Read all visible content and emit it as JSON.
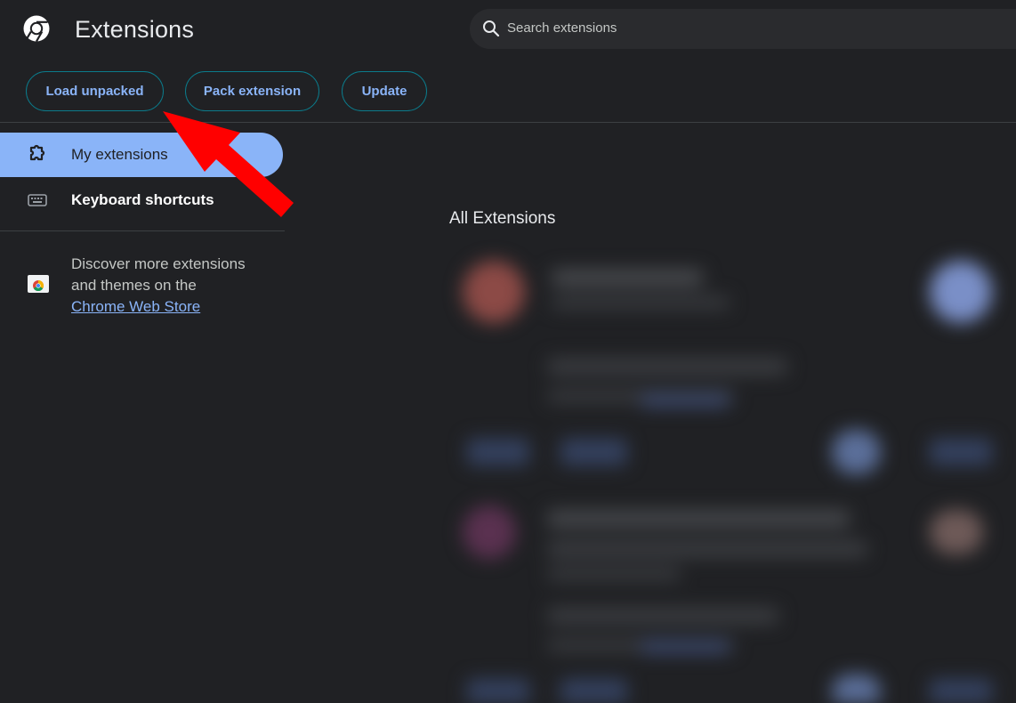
{
  "header": {
    "title": "Extensions",
    "logo_icon": "chrome-logo-icon",
    "search": {
      "placeholder": "Search extensions",
      "icon": "search-icon"
    }
  },
  "toolbar": {
    "load_unpacked": "Load unpacked",
    "pack_extension": "Pack extension",
    "update": "Update"
  },
  "sidebar": {
    "items": [
      {
        "label": "My extensions",
        "icon": "puzzle-icon",
        "active": true
      },
      {
        "label": "Keyboard shortcuts",
        "icon": "keyboard-icon",
        "active": false
      }
    ],
    "discover": {
      "line1": "Discover more extensions and themes on the",
      "link": "Chrome Web Store",
      "icon": "chrome-web-store-icon"
    }
  },
  "main": {
    "section_title": "All Extensions",
    "content_blurred": true
  },
  "annotation": {
    "type": "arrow",
    "color": "#ff0000",
    "points_to": "Load unpacked"
  },
  "colors": {
    "background": "#202124",
    "accent": "#8ab4f8",
    "button_border": "#0b7b8b",
    "annotation": "#ff0000"
  }
}
